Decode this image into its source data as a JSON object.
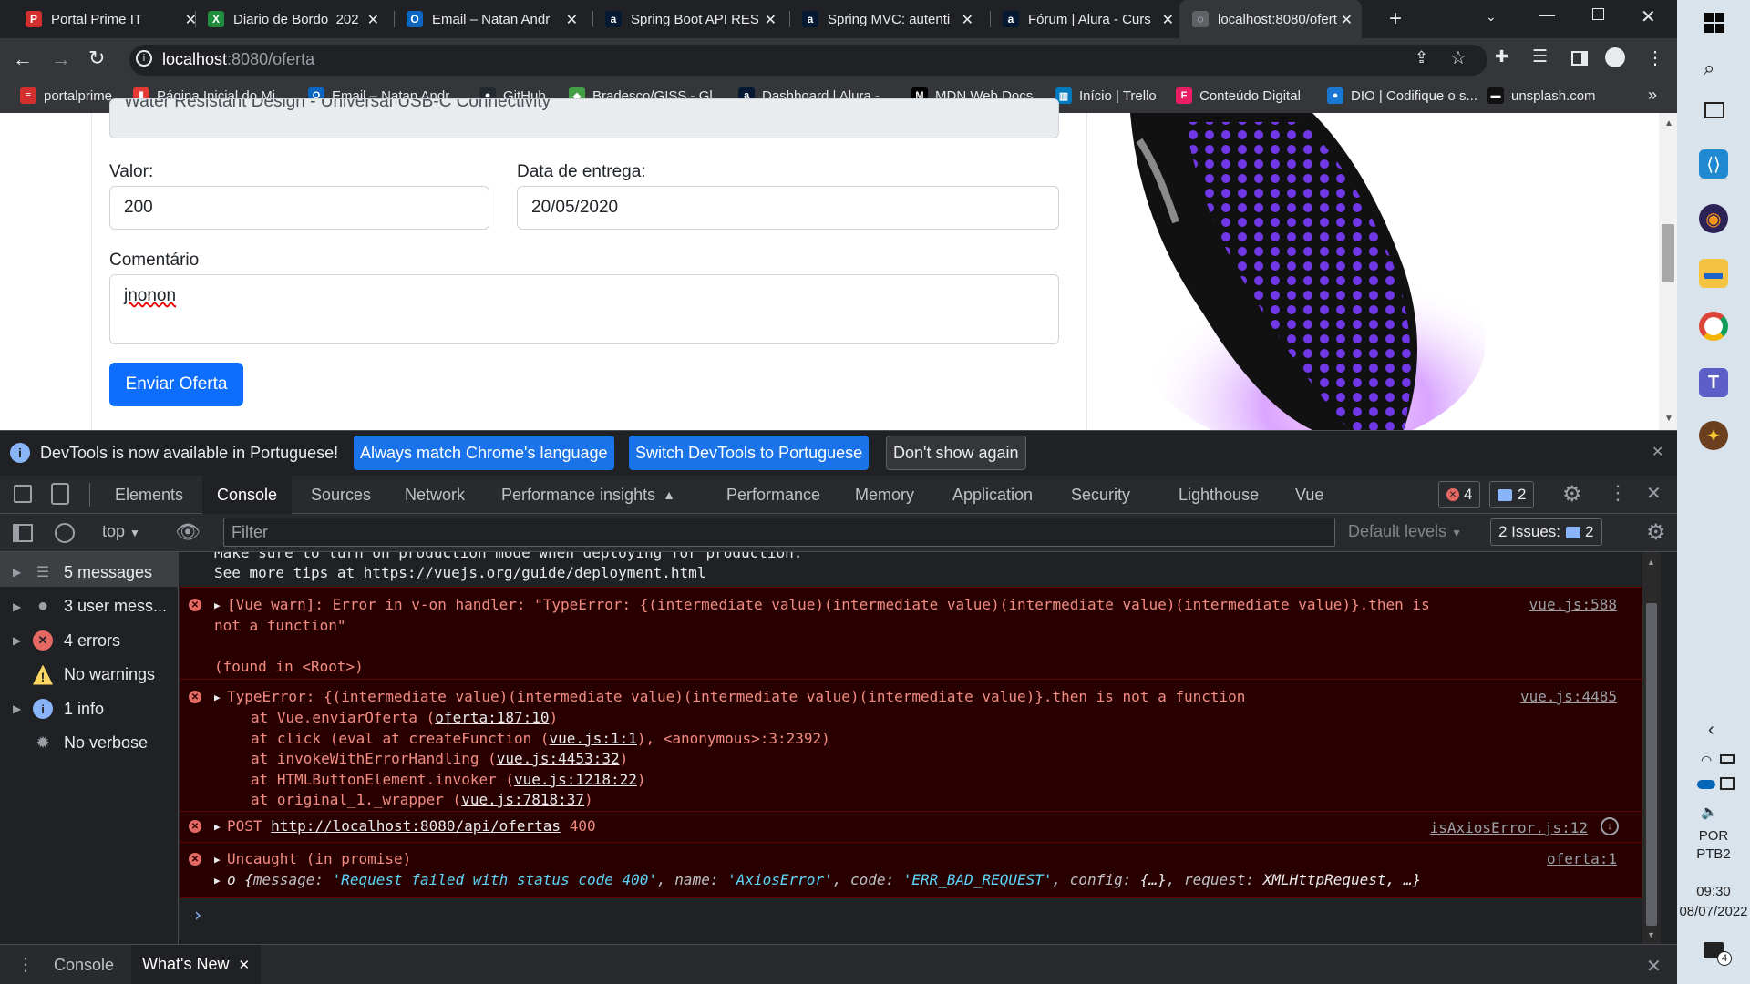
{
  "browser": {
    "tabs": [
      {
        "title": "Portal Prime IT",
        "color": "#d32f2f",
        "glyph": "P"
      },
      {
        "title": "Diario de Bordo_202",
        "color": "#1e8e3e",
        "glyph": "X"
      },
      {
        "title": "Email – Natan Andr",
        "color": "#0a66c2",
        "glyph": "O"
      },
      {
        "title": "Spring Boot API RES",
        "color": "#051933",
        "glyph": "a"
      },
      {
        "title": "Spring MVC: autenti",
        "color": "#051933",
        "glyph": "a"
      },
      {
        "title": "Fórum | Alura - Curs",
        "color": "#051933",
        "glyph": "a"
      },
      {
        "title": "localhost:8080/ofert",
        "color": "#5f6368",
        "glyph": "◌"
      }
    ],
    "url_host": "localhost",
    "url_path": ":8080/oferta",
    "bookmarks": [
      {
        "label": "portalprime",
        "color": "#d32f2f",
        "glyph": "≡"
      },
      {
        "label": "Página Inicial do Mi...",
        "color": "#e53935",
        "glyph": "❚"
      },
      {
        "label": "Email – Natan Andr...",
        "color": "#0a66c2",
        "glyph": "O"
      },
      {
        "label": "GitHub",
        "color": "#24292f",
        "glyph": "●"
      },
      {
        "label": "Bradesco/GISS - Gl...",
        "color": "#43a047",
        "glyph": "◆"
      },
      {
        "label": "Dashboard | Alura -...",
        "color": "#051933",
        "glyph": "a"
      },
      {
        "label": "MDN Web Docs",
        "color": "#000000",
        "glyph": "M"
      },
      {
        "label": "Início | Trello",
        "color": "#0079bf",
        "glyph": "▥"
      },
      {
        "label": "Conteúdo Digital",
        "color": "#e91e63",
        "glyph": "F"
      },
      {
        "label": "DIO | Codifique o s...",
        "color": "#1976d2",
        "glyph": "●"
      },
      {
        "label": "unsplash.com",
        "color": "#111111",
        "glyph": "▬"
      }
    ],
    "bookmarks_overflow": "»"
  },
  "form": {
    "partial_text": "Water Resistant Design - Universal USB-C Connectivity",
    "valor_label": "Valor:",
    "valor_value": "200",
    "data_label": "Data de entrega:",
    "data_value": "20/05/2020",
    "comentario_label": "Comentário",
    "comentario_value": "jnonon",
    "submit_label": "Enviar Oferta"
  },
  "infobar": {
    "message": "DevTools is now available in Portuguese!",
    "btn_match": "Always match Chrome's language",
    "btn_switch": "Switch DevTools to Portuguese",
    "btn_dismiss": "Don't show again"
  },
  "devtools": {
    "tabs": [
      "Elements",
      "Console",
      "Sources",
      "Network",
      "Performance insights",
      "Performance",
      "Memory",
      "Application",
      "Security",
      "Lighthouse",
      "Vue"
    ],
    "error_count": "4",
    "message_count": "2",
    "context": "top",
    "filter_placeholder": "Filter",
    "levels": "Default levels",
    "issues_label": "2 Issues:",
    "issues_count": "2",
    "sidebar": [
      {
        "label": "5 messages",
        "icon": "list-icon"
      },
      {
        "label": "3 user mess...",
        "icon": "user-icon"
      },
      {
        "label": "4 errors",
        "icon": "error-icon"
      },
      {
        "label": "No warnings",
        "icon": "warning-icon"
      },
      {
        "label": "1 info",
        "icon": "info-icon"
      },
      {
        "label": "No verbose",
        "icon": "bug-icon"
      }
    ],
    "drawer_tabs": [
      "Console",
      "What's New"
    ]
  },
  "console": {
    "top_line1": "Make sure to turn on production mode when deploying for production.",
    "top_line2_prefix": "See more tips at ",
    "top_line2_link": "https://vuejs.org/guide/deployment.html",
    "vue_warn_line1": "[Vue warn]: Error in v-on handler: \"TypeError: {(intermediate value)(intermediate value)(intermediate value)(intermediate value)}.then is",
    "vue_warn_line2": "not a function\"",
    "vue_warn_found": "(found in <Root>)",
    "vue_warn_src": "vue.js:588",
    "typeerror_line": "TypeError: {(intermediate value)(intermediate value)(intermediate value)(intermediate value)}.then is not a function",
    "typeerror_src": "vue.js:4485",
    "stack": [
      {
        "pre": "at Vue.enviarOferta (",
        "link": "oferta:187:10",
        "post": ")"
      },
      {
        "pre": "at click (eval at createFunction (",
        "link": "vue.js:1:1",
        "post": "), <anonymous>:3:2392)"
      },
      {
        "pre": "at invokeWithErrorHandling (",
        "link": "vue.js:4453:32",
        "post": ")"
      },
      {
        "pre": "at HTMLButtonElement.invoker (",
        "link": "vue.js:1218:22",
        "post": ")"
      },
      {
        "pre": "at original_1._wrapper (",
        "link": "vue.js:7818:37",
        "post": ")"
      }
    ],
    "post_method": "POST ",
    "post_url": "http://localhost:8080/api/ofertas",
    "post_status": " 400",
    "post_src": "isAxiosError.js:12",
    "uncaught": "Uncaught (in promise)",
    "uncaught_src": "oferta:1",
    "obj_o": "o",
    "obj_open": " {",
    "obj_k_message": "message: ",
    "obj_v_message": "'Request failed with status code 400'",
    "obj_k_name": ", name: ",
    "obj_v_name": "'AxiosError'",
    "obj_k_code": ", code: ",
    "obj_v_code": "'ERR_BAD_REQUEST'",
    "obj_k_config": ", config: ",
    "obj_v_config": "{…}",
    "obj_k_request": ", request: ",
    "obj_v_request": "XMLHttpRequest",
    "obj_close": ", …}",
    "prompt": "›"
  },
  "taskbar": {
    "lang1": "POR",
    "lang2": "PTB2",
    "time": "09:30",
    "date": "08/07/2022",
    "notif_count": "4"
  }
}
